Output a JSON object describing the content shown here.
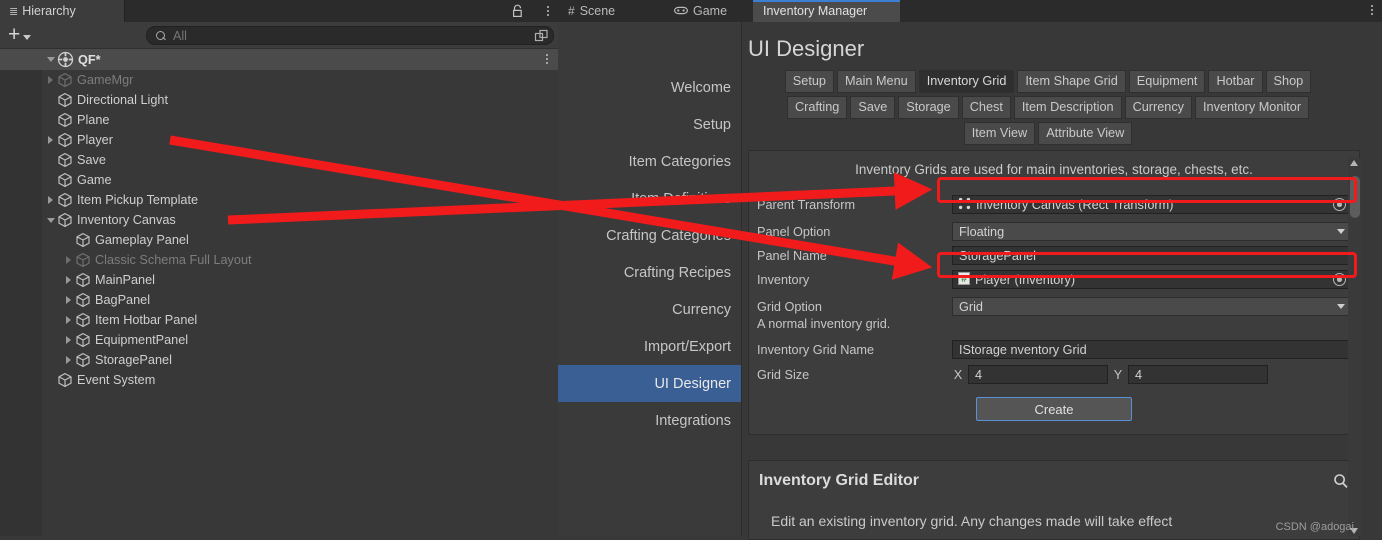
{
  "hierarchy": {
    "tab_label": "Hierarchy",
    "tab_icon": "hierarchy-icon",
    "lock_icon": "lock-icon",
    "menu_icon": "kebab-menu-icon",
    "add_button_label": "+",
    "search": {
      "placeholder": "All",
      "value": "",
      "icon": "search-icon",
      "expand_icon": "expand-icon"
    },
    "scene_root": {
      "label": "QF*",
      "icon": "unity-scene-icon",
      "expanded": true
    },
    "items": [
      {
        "label": "GameMgr",
        "depth": 1,
        "arrow": "collapsed",
        "dim": true
      },
      {
        "label": "Directional Light",
        "depth": 1,
        "arrow": "none",
        "dim": false
      },
      {
        "label": "Plane",
        "depth": 1,
        "arrow": "none",
        "dim": false
      },
      {
        "label": "Player",
        "depth": 1,
        "arrow": "collapsed",
        "dim": false
      },
      {
        "label": "Save",
        "depth": 1,
        "arrow": "none",
        "dim": false
      },
      {
        "label": "Game",
        "depth": 1,
        "arrow": "none",
        "dim": false
      },
      {
        "label": "Item Pickup Template",
        "depth": 1,
        "arrow": "collapsed",
        "dim": false
      },
      {
        "label": "Inventory Canvas",
        "depth": 1,
        "arrow": "expanded",
        "dim": false
      },
      {
        "label": "Gameplay Panel",
        "depth": 2,
        "arrow": "none",
        "dim": false
      },
      {
        "label": "Classic Schema Full Layout",
        "depth": 2,
        "arrow": "collapsed",
        "dim": true
      },
      {
        "label": "MainPanel",
        "depth": 2,
        "arrow": "collapsed",
        "dim": false
      },
      {
        "label": "BagPanel",
        "depth": 2,
        "arrow": "collapsed",
        "dim": false
      },
      {
        "label": "Item Hotbar Panel",
        "depth": 2,
        "arrow": "collapsed",
        "dim": false
      },
      {
        "label": "EquipmentPanel",
        "depth": 2,
        "arrow": "collapsed",
        "dim": false
      },
      {
        "label": "StoragePanel",
        "depth": 2,
        "arrow": "collapsed",
        "dim": false
      },
      {
        "label": "Event System",
        "depth": 1,
        "arrow": "none",
        "dim": false
      }
    ]
  },
  "window": {
    "tabs": [
      {
        "label": "Scene",
        "icon": "grid-icon",
        "active": false
      },
      {
        "label": "Game",
        "icon": "gamepad-icon",
        "active": false
      },
      {
        "label": "Inventory Manager",
        "icon": "none",
        "active": true
      }
    ],
    "menu_icon": "kebab-menu-icon",
    "accent_color": "#3c7fd1"
  },
  "nav": {
    "items": [
      {
        "label": "Welcome",
        "selected": false
      },
      {
        "label": "Setup",
        "selected": false
      },
      {
        "label": "Item Categories",
        "selected": false
      },
      {
        "label": "Item Definitions",
        "selected": false
      },
      {
        "label": "Crafting Categories",
        "selected": false
      },
      {
        "label": "Crafting Recipes",
        "selected": false
      },
      {
        "label": "Currency",
        "selected": false
      },
      {
        "label": "Import/Export",
        "selected": false
      },
      {
        "label": "UI Designer",
        "selected": true
      },
      {
        "label": "Integrations",
        "selected": false
      }
    ],
    "selected_color": "#3a5f94"
  },
  "designer": {
    "title": "UI Designer",
    "tab_rows": [
      [
        {
          "label": "Setup",
          "active": false
        },
        {
          "label": "Main Menu",
          "active": false
        },
        {
          "label": "Inventory Grid",
          "active": true
        },
        {
          "label": "Item Shape Grid",
          "active": false
        },
        {
          "label": "Equipment",
          "active": false
        },
        {
          "label": "Hotbar",
          "active": false
        },
        {
          "label": "Shop",
          "active": false
        }
      ],
      [
        {
          "label": "Crafting",
          "active": false
        },
        {
          "label": "Save",
          "active": false
        },
        {
          "label": "Storage",
          "active": false
        },
        {
          "label": "Chest",
          "active": false
        },
        {
          "label": "Item Description",
          "active": false
        },
        {
          "label": "Currency",
          "active": false
        },
        {
          "label": "Inventory Monitor",
          "active": false
        }
      ],
      [
        {
          "label": "Item View",
          "active": false
        },
        {
          "label": "Attribute View",
          "active": false
        }
      ]
    ],
    "description": "Inventory Grids are used for main inventories, storage, chests, etc.",
    "fields": {
      "parent_transform": {
        "label": "Parent Transform",
        "value": "Inventory Canvas (Rect Transform)",
        "icon": "rect-transform-icon",
        "picker_icon": "object-picker-icon",
        "highlighted": true
      },
      "panel_option": {
        "label": "Panel Option",
        "value": "Floating",
        "caret_icon": "chevron-down-icon"
      },
      "panel_name": {
        "label": "Panel Name",
        "value": "StoragePanel"
      },
      "inventory": {
        "label": "Inventory",
        "value": "Player (Inventory)",
        "icon": "script-icon",
        "picker_icon": "object-picker-icon",
        "highlighted": true
      },
      "grid_option": {
        "label": "Grid Option",
        "value": "Grid",
        "caret_icon": "chevron-down-icon"
      },
      "grid_option_help": "A normal inventory grid.",
      "grid_name": {
        "label": "Inventory Grid Name",
        "value": "IStorage nventory Grid"
      },
      "grid_size": {
        "label": "Grid Size",
        "x_label": "X",
        "x_value": "4",
        "y_label": "Y",
        "y_value": "4"
      }
    },
    "create_button": "Create"
  },
  "grid_editor": {
    "title": "Inventory Grid Editor",
    "search_icon": "search-icon",
    "body": "Edit an existing inventory grid. Any changes made will take effect"
  },
  "scrollbar": {
    "up_icon": "triangle-up-icon",
    "down_icon": "triangle-down-icon"
  },
  "watermark": "CSDN @adogai",
  "annotation": {
    "color": "#f21b1b",
    "arrows": [
      {
        "from": "Inventory Canvas (hierarchy)",
        "to": "Parent Transform field"
      },
      {
        "from": "Player (hierarchy)",
        "to": "Inventory field"
      }
    ]
  }
}
